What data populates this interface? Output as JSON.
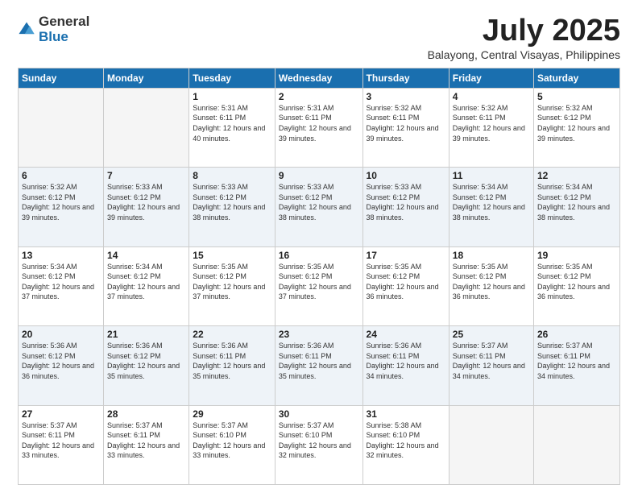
{
  "logo": {
    "general": "General",
    "blue": "Blue"
  },
  "title": "July 2025",
  "subtitle": "Balayong, Central Visayas, Philippines",
  "headers": [
    "Sunday",
    "Monday",
    "Tuesday",
    "Wednesday",
    "Thursday",
    "Friday",
    "Saturday"
  ],
  "weeks": [
    [
      {
        "day": "",
        "info": ""
      },
      {
        "day": "",
        "info": ""
      },
      {
        "day": "1",
        "info": "Sunrise: 5:31 AM\nSunset: 6:11 PM\nDaylight: 12 hours and 40 minutes."
      },
      {
        "day": "2",
        "info": "Sunrise: 5:31 AM\nSunset: 6:11 PM\nDaylight: 12 hours and 39 minutes."
      },
      {
        "day": "3",
        "info": "Sunrise: 5:32 AM\nSunset: 6:11 PM\nDaylight: 12 hours and 39 minutes."
      },
      {
        "day": "4",
        "info": "Sunrise: 5:32 AM\nSunset: 6:11 PM\nDaylight: 12 hours and 39 minutes."
      },
      {
        "day": "5",
        "info": "Sunrise: 5:32 AM\nSunset: 6:12 PM\nDaylight: 12 hours and 39 minutes."
      }
    ],
    [
      {
        "day": "6",
        "info": "Sunrise: 5:32 AM\nSunset: 6:12 PM\nDaylight: 12 hours and 39 minutes."
      },
      {
        "day": "7",
        "info": "Sunrise: 5:33 AM\nSunset: 6:12 PM\nDaylight: 12 hours and 39 minutes."
      },
      {
        "day": "8",
        "info": "Sunrise: 5:33 AM\nSunset: 6:12 PM\nDaylight: 12 hours and 38 minutes."
      },
      {
        "day": "9",
        "info": "Sunrise: 5:33 AM\nSunset: 6:12 PM\nDaylight: 12 hours and 38 minutes."
      },
      {
        "day": "10",
        "info": "Sunrise: 5:33 AM\nSunset: 6:12 PM\nDaylight: 12 hours and 38 minutes."
      },
      {
        "day": "11",
        "info": "Sunrise: 5:34 AM\nSunset: 6:12 PM\nDaylight: 12 hours and 38 minutes."
      },
      {
        "day": "12",
        "info": "Sunrise: 5:34 AM\nSunset: 6:12 PM\nDaylight: 12 hours and 38 minutes."
      }
    ],
    [
      {
        "day": "13",
        "info": "Sunrise: 5:34 AM\nSunset: 6:12 PM\nDaylight: 12 hours and 37 minutes."
      },
      {
        "day": "14",
        "info": "Sunrise: 5:34 AM\nSunset: 6:12 PM\nDaylight: 12 hours and 37 minutes."
      },
      {
        "day": "15",
        "info": "Sunrise: 5:35 AM\nSunset: 6:12 PM\nDaylight: 12 hours and 37 minutes."
      },
      {
        "day": "16",
        "info": "Sunrise: 5:35 AM\nSunset: 6:12 PM\nDaylight: 12 hours and 37 minutes."
      },
      {
        "day": "17",
        "info": "Sunrise: 5:35 AM\nSunset: 6:12 PM\nDaylight: 12 hours and 36 minutes."
      },
      {
        "day": "18",
        "info": "Sunrise: 5:35 AM\nSunset: 6:12 PM\nDaylight: 12 hours and 36 minutes."
      },
      {
        "day": "19",
        "info": "Sunrise: 5:35 AM\nSunset: 6:12 PM\nDaylight: 12 hours and 36 minutes."
      }
    ],
    [
      {
        "day": "20",
        "info": "Sunrise: 5:36 AM\nSunset: 6:12 PM\nDaylight: 12 hours and 36 minutes."
      },
      {
        "day": "21",
        "info": "Sunrise: 5:36 AM\nSunset: 6:12 PM\nDaylight: 12 hours and 35 minutes."
      },
      {
        "day": "22",
        "info": "Sunrise: 5:36 AM\nSunset: 6:11 PM\nDaylight: 12 hours and 35 minutes."
      },
      {
        "day": "23",
        "info": "Sunrise: 5:36 AM\nSunset: 6:11 PM\nDaylight: 12 hours and 35 minutes."
      },
      {
        "day": "24",
        "info": "Sunrise: 5:36 AM\nSunset: 6:11 PM\nDaylight: 12 hours and 34 minutes."
      },
      {
        "day": "25",
        "info": "Sunrise: 5:37 AM\nSunset: 6:11 PM\nDaylight: 12 hours and 34 minutes."
      },
      {
        "day": "26",
        "info": "Sunrise: 5:37 AM\nSunset: 6:11 PM\nDaylight: 12 hours and 34 minutes."
      }
    ],
    [
      {
        "day": "27",
        "info": "Sunrise: 5:37 AM\nSunset: 6:11 PM\nDaylight: 12 hours and 33 minutes."
      },
      {
        "day": "28",
        "info": "Sunrise: 5:37 AM\nSunset: 6:11 PM\nDaylight: 12 hours and 33 minutes."
      },
      {
        "day": "29",
        "info": "Sunrise: 5:37 AM\nSunset: 6:10 PM\nDaylight: 12 hours and 33 minutes."
      },
      {
        "day": "30",
        "info": "Sunrise: 5:37 AM\nSunset: 6:10 PM\nDaylight: 12 hours and 32 minutes."
      },
      {
        "day": "31",
        "info": "Sunrise: 5:38 AM\nSunset: 6:10 PM\nDaylight: 12 hours and 32 minutes."
      },
      {
        "day": "",
        "info": ""
      },
      {
        "day": "",
        "info": ""
      }
    ]
  ]
}
